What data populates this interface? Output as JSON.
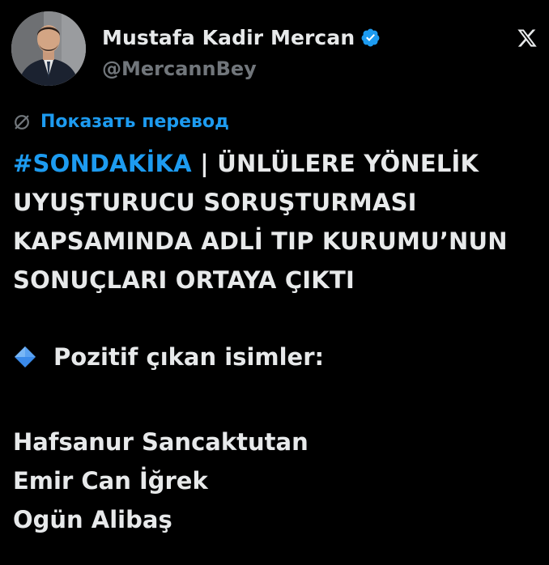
{
  "author": {
    "display_name": "Mustafa Kadir Mercan",
    "handle": "@MercannBey",
    "verified": true,
    "avatar_icon": "profile-photo-icon",
    "verified_icon": "verified-badge-icon"
  },
  "platform_icon": "x-logo-icon",
  "translate": {
    "icon": "globe-icon",
    "label": "Показать перевод"
  },
  "tweet": {
    "hashtag": "#SONDAKİKA",
    "separator": " | ",
    "headline_rest_line1": "ÜNLÜLERE YÖNELİK",
    "headline_line2": "UYUŞTURUCU SORUŞTURMASI",
    "headline_line3": "KAPSAMINDA ADLİ TIP KURUMU’NUN",
    "headline_line4": "SONUÇLARI ORTAYA ÇIKTI",
    "section_icon": "blue-diamond-icon",
    "section_title": "Pozitif çıkan isimler:",
    "names": [
      "Hafsanur Sancaktutan",
      "Emir Can İğrek",
      "Ogün Alibaş"
    ]
  },
  "colors": {
    "background": "#000000",
    "text": "#e7e9ea",
    "secondary_text": "#71767b",
    "accent": "#1d9bf0"
  }
}
